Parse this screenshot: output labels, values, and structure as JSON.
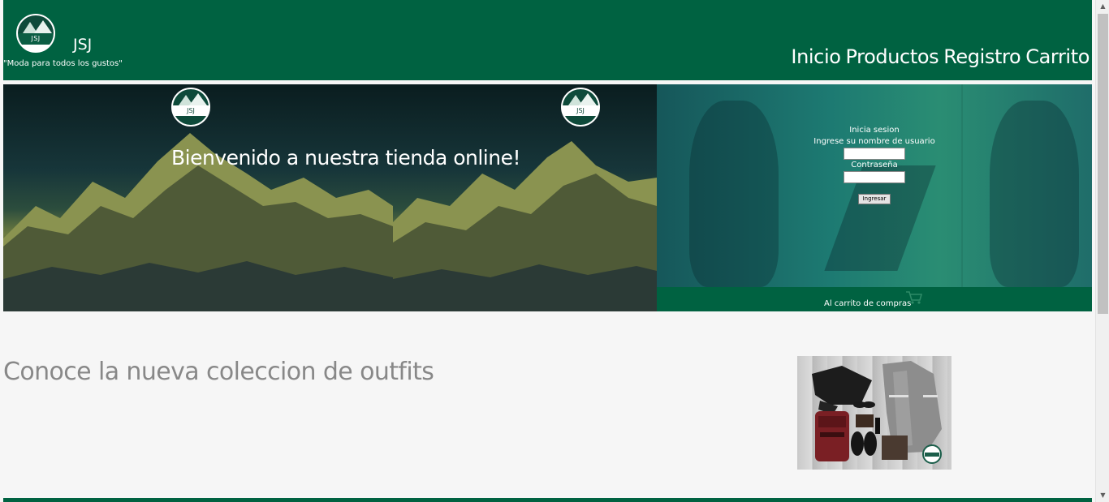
{
  "header": {
    "logo_text": "JSJ",
    "brand": "JSJ",
    "tagline": "\"Moda para todos los gustos\"",
    "nav": [
      "Inicio",
      "Productos",
      "Registro",
      "Carrito"
    ]
  },
  "hero": {
    "logo_text": "JSJ",
    "title": "Bienvenido a nuestra tienda online!"
  },
  "login": {
    "heading": "Inicia sesion",
    "username_label": "Ingrese su nombre de usuario",
    "username_value": "",
    "password_label": "Contraseña",
    "password_value": "",
    "submit_label": "Ingresar"
  },
  "cart": {
    "label": "Al carrito de compras",
    "icon": "shopping-cart-icon"
  },
  "content": {
    "headline": "Conoce la nueva coleccion de outfits",
    "image_alt": "outfit collection photo"
  },
  "colors": {
    "brand_green": "#006241",
    "background": "#f6f6f6",
    "headline_gray": "#888888"
  }
}
